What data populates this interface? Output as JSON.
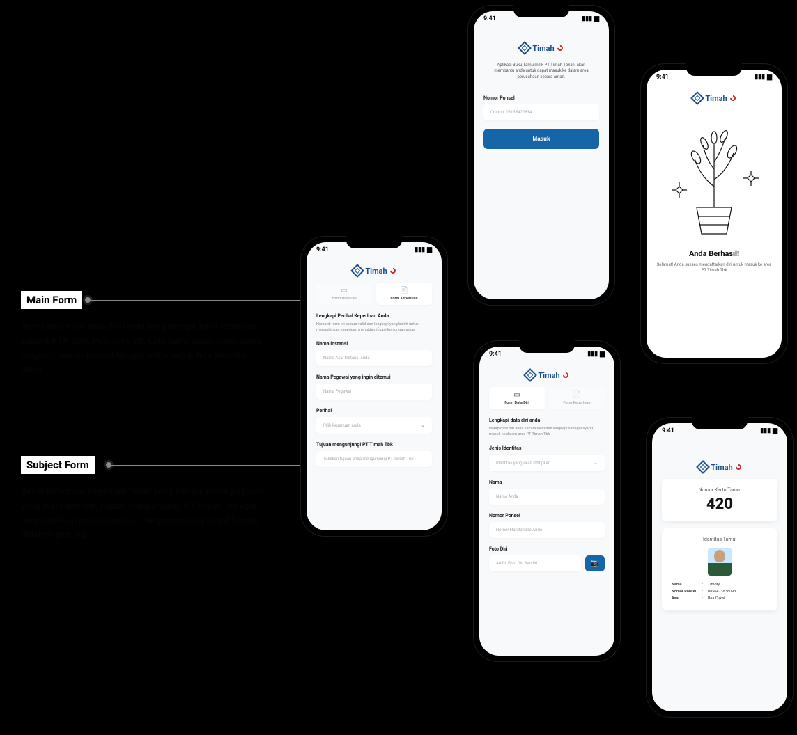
{
  "status": {
    "time": "9:41"
  },
  "brand": {
    "name": "Timah"
  },
  "annotations": {
    "mainForm": {
      "title": "Main Form",
      "body": "Berisi informasi data diri tamu yang berupa jenis identitas seperti KTP, SIM, Passport, dll. Lalu tamu dapat input nama lengkap, nomor ponsel hingga selfie untuk foto identitas tamu."
    },
    "subjectForm": {
      "title": "Subject Form",
      "body": "Berisi informasi keperluan tamu yang berupa nama pegawai yang ingin ditemui, tujuan mengunjungi PT Timah, dll agar memudahkan proses masuk, dan proses tanya saat berada didalam gedung."
    }
  },
  "screens": {
    "login": {
      "intro": "Aplikasi Buku Tamu milik PT Timah Tbk ini akan membantu anda untuk dapat masuk ke dalam area perusahaan secara aman.",
      "phoneLabel": "Nomor Ponsel",
      "phonePlaceholder": "Contoh: 08135420634",
      "submit": "Masuk"
    },
    "success": {
      "title": "Anda Berhasil!",
      "sub": "Selamat! Anda sukses mendaftarkan diri untuk masuk ke area PT Timah Tbk"
    },
    "formDetail": {
      "tabs": {
        "data": "Form Data Diri",
        "keperluan": "Form Keperluan"
      },
      "heading": "Lengkapi Perihal Keperluan Anda",
      "sub": "Harap di form ini secara valid dan lengkapi yang boleh untuk memudahkan keperluan mengidentifikasi kunjungan anda.",
      "instansiLabel": "Nama Instansi",
      "instansiPlaceholder": "Nama Asal Instansi anda",
      "pegawaiLabel": "Nama Pegawai yang ingin ditemui",
      "pegawaiPlaceholder": "Nama Pegawai",
      "perihalLabel": "Perihal",
      "perihalPlaceholder": "Pilih keperluan anda",
      "tujuanLabel": "Tujuan mengunjungi PT Timah Tbk",
      "tujuanPlaceholder": "Tuliskan tujuan anda mengunjungi PT Timah Tbk"
    },
    "formData": {
      "tabs": {
        "data": "Form Data Diri",
        "keperluan": "Form Keperluan"
      },
      "heading": "Lengkapi data diri anda",
      "sub": "Harap data diri anda secara valid dan lengkapi sebagai syarat masuk ke dalam area PT Timah Tbk",
      "idLabel": "Jenis Identitas",
      "idPlaceholder": "Identitas yang akan dititipkan",
      "nameLabel": "Nama",
      "namePlaceholder": "Nama Anda",
      "phoneLabel": "Nomor Ponsel",
      "phonePlaceholder": "Nomor Handphone Anda",
      "photoLabel": "Foto Diri",
      "photoPlaceholder": "Ambil Foto Diri Sendiri"
    },
    "guestCard": {
      "numLabel": "Nomor Kartu Tamu:",
      "num": "420",
      "idLabel": "Identitas Tamu:",
      "fields": {
        "nameKey": "Nama",
        "nameVal": "Timoty",
        "phoneKey": "Nomor Ponsel",
        "phoneVal": "0856473838093",
        "asalKey": "Asal",
        "asalVal": "Bea Cukai"
      }
    }
  }
}
